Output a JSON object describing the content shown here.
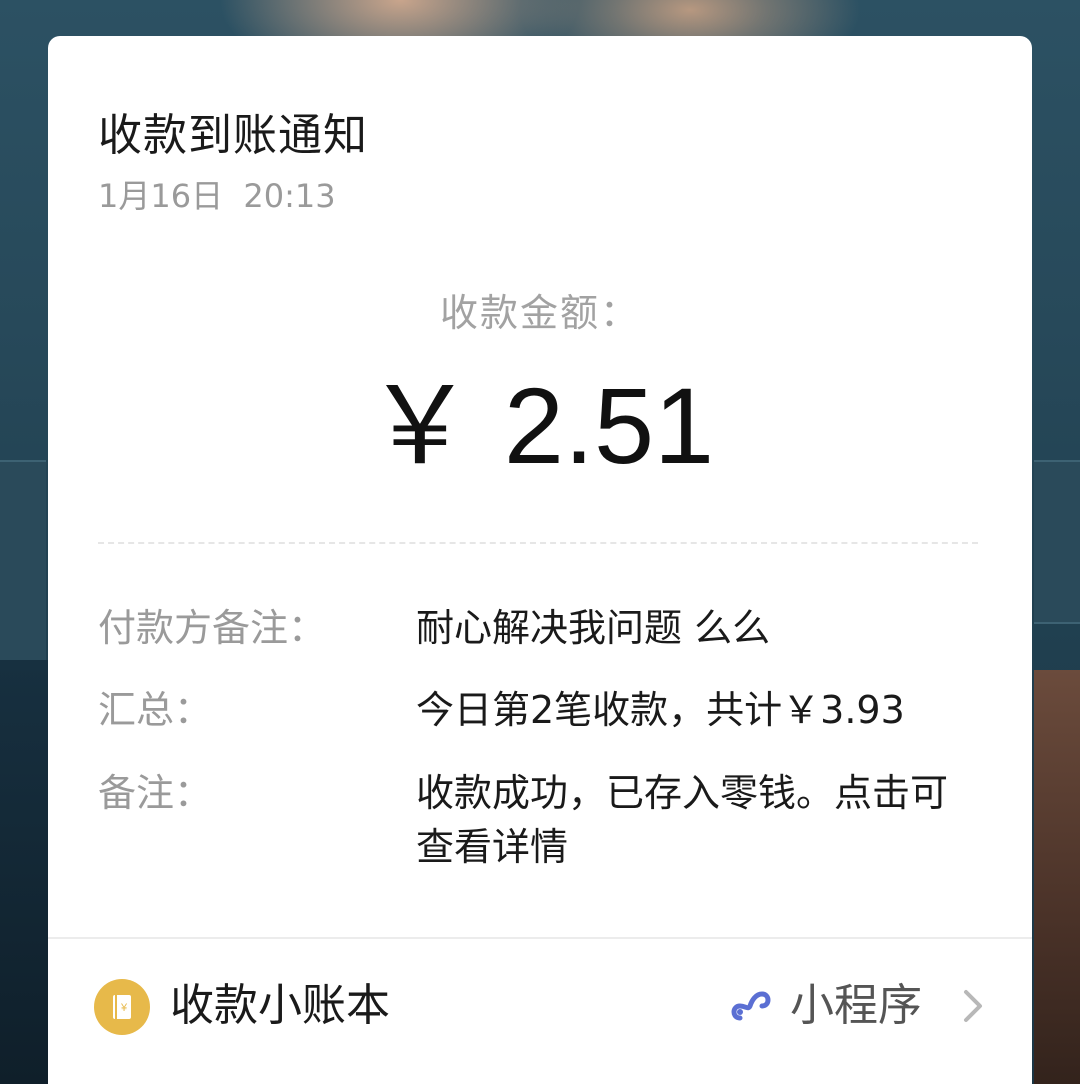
{
  "notification": {
    "title": "收款到账通知",
    "datetime": "1月16日  20:13",
    "amount_label": "收款金额：",
    "currency_symbol": "￥",
    "amount": "2.51",
    "rows": [
      {
        "label": "付款方备注：",
        "value": "耐心解决我问题 么么"
      },
      {
        "label": "汇总：",
        "value": "今日第2笔收款，共计￥3.93"
      },
      {
        "label": "备注：",
        "value": "收款成功，已存入零钱。点击可查看详情"
      }
    ]
  },
  "footer": {
    "app_name": "收款小账本",
    "app_icon": "ledger-icon",
    "mini_program_label": "小程序",
    "mini_program_icon": "mini-program-icon",
    "chevron_icon": "chevron-right-icon"
  },
  "colors": {
    "card_bg": "#ffffff",
    "muted_text": "#9a9a9a",
    "primary_text": "#1a1a1a",
    "app_icon_bg": "#e7b94a",
    "mini_program_icon": "#5b6fd3"
  }
}
